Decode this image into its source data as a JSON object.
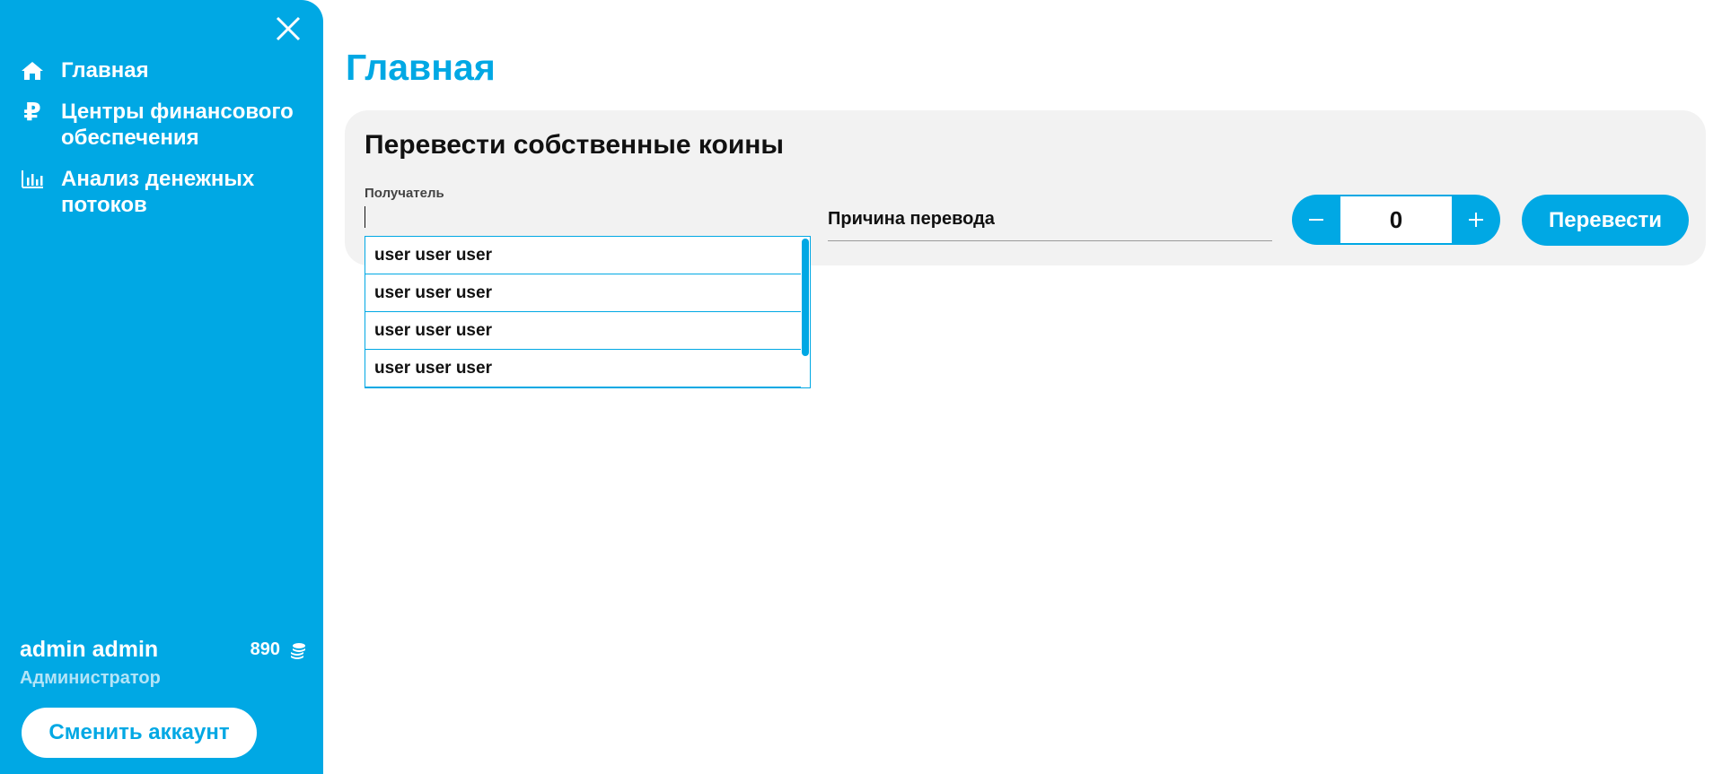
{
  "sidebar": {
    "items": [
      {
        "label": "Главная",
        "icon": "home-icon"
      },
      {
        "label": "Центры финансового обеспечения",
        "icon": "ruble-icon",
        "glyph": "₽"
      },
      {
        "label": "Анализ денежных потоков",
        "icon": "bar-chart-icon"
      }
    ],
    "user": {
      "name": "admin admin",
      "balance": "890",
      "role": "Администратор"
    },
    "switch_account_label": "Сменить аккаунт"
  },
  "main": {
    "title": "Главная",
    "transfer_card": {
      "title": "Перевести собственные коины",
      "recipient_label": "Получатель",
      "recipient_value": "",
      "reason_placeholder": "Причина перевода",
      "amount": "0",
      "transfer_button": "Перевести"
    },
    "recipient_suggestions": [
      "user user user",
      "user user user",
      "user user user",
      "user user user"
    ]
  },
  "colors": {
    "accent": "#00a8e4",
    "card_background": "#f2f2f2",
    "role_text": "#b3e4f7"
  }
}
